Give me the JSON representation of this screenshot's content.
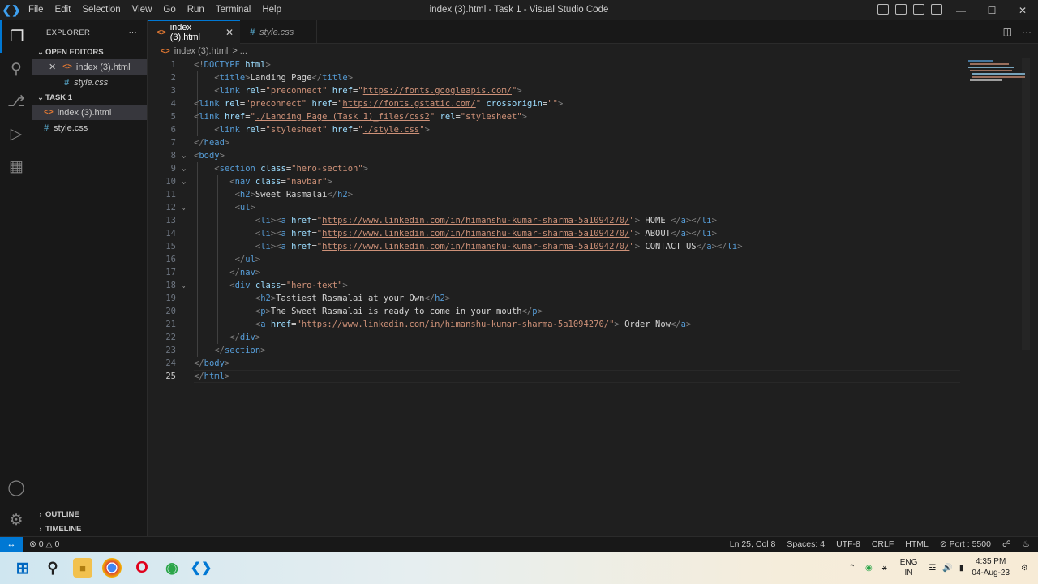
{
  "titlebar": {
    "menu": [
      "File",
      "Edit",
      "Selection",
      "View",
      "Go",
      "Run",
      "Terminal",
      "Help"
    ],
    "title": "index (3).html - Task 1 - Visual Studio Code"
  },
  "sidebar": {
    "title": "EXPLORER",
    "more": "···",
    "open_editors_label": "OPEN EDITORS",
    "open_editors": [
      "index (3).html",
      "style.css"
    ],
    "folder_label": "TASK 1",
    "files": [
      "index (3).html",
      "style.css"
    ],
    "outline_label": "OUTLINE",
    "timeline_label": "TIMELINE"
  },
  "tabs": [
    {
      "label": "index (3).html",
      "active": true
    },
    {
      "label": "style.css",
      "active": false
    }
  ],
  "breadcrumb": {
    "file": "index (3).html",
    "rest": "> ..."
  },
  "code_lines": [
    "1",
    "2",
    "3",
    "4",
    "5",
    "6",
    "7",
    "8",
    "9",
    "10",
    "11",
    "12",
    "13",
    "14",
    "15",
    "16",
    "17",
    "18",
    "19",
    "20",
    "21",
    "22",
    "23",
    "24",
    "25"
  ],
  "code": {
    "l1": [
      "<!",
      "DOCTYPE",
      " html",
      ">"
    ],
    "l2": [
      "Landing Page"
    ],
    "url_fonts": "https://fonts.googleapis.com/",
    "url_gstatic": "https://fonts.gstatic.com/",
    "css2": "./Landing Page (Task 1)_files/css2",
    "style": "./style.css",
    "hero_section": "hero-section",
    "navbar": "navbar",
    "brand": "Sweet Rasmalai",
    "linkedin": "https://www.linkedin.com/in/himanshu-kumar-sharma-5a1094270/",
    "home": " HOME ",
    "about": " ABOUT",
    "contact": " CONTACT US",
    "hero_text": "hero-text",
    "h2": "Tastiest Rasmalai at your Own",
    "p": "The Sweet Rasmalai is ready to come in your mouth",
    "order": " Order Now"
  },
  "statusbar": {
    "errors": "0",
    "warnings": "0",
    "position": "Ln 25, Col 8",
    "spaces": "Spaces: 4",
    "encoding": "UTF-8",
    "eol": "CRLF",
    "language": "HTML",
    "port": "Port : 5500"
  },
  "taskbar": {
    "lang_top": "ENG",
    "lang_bottom": "IN",
    "time": "4:35 PM",
    "date": "04-Aug-23"
  },
  "colors": {
    "accent": "#0078d4",
    "tag": "#569cd6",
    "attr": "#9cdcfe",
    "string": "#ce9178"
  }
}
